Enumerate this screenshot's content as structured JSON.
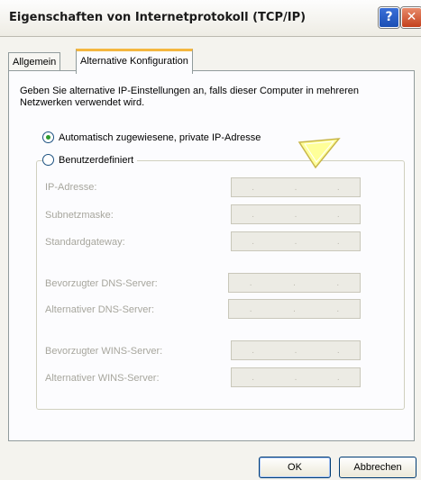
{
  "window": {
    "title": "Eigenschaften von Internetprotokoll (TCP/IP)",
    "help_glyph": "?",
    "close_glyph": "✕"
  },
  "tabs": [
    {
      "label": "Allgemein",
      "selected": false
    },
    {
      "label": "Alternative Konfiguration",
      "selected": true
    }
  ],
  "intro_text": "Geben Sie alternative IP-Einstellungen an, falls dieser Computer in mehreren Netzwerken verwendet wird.",
  "options": {
    "auto_label": "Automatisch zugewiesene, private IP-Adresse",
    "auto_selected": true,
    "custom_label": "Benutzerdefiniert",
    "custom_selected": false
  },
  "fields": {
    "ip_address": "IP-Adresse:",
    "subnet_mask": "Subnetzmaske:",
    "default_gateway": "Standardgateway:",
    "preferred_dns": "Bevorzugter DNS-Server:",
    "alternate_dns": "Alternativer DNS-Server:",
    "preferred_wins": "Bevorzugter WINS-Server:",
    "alternate_wins": "Alternativer WINS-Server:"
  },
  "ip_separator": ".",
  "buttons": {
    "ok": "OK",
    "cancel": "Abbrechen"
  },
  "colors": {
    "tab_highlight": "#f4b740",
    "disabled_text": "#a7a69d",
    "radio_dot": "#2d9b2d",
    "tooltip_arrow": "#ffff99"
  },
  "icons": {
    "help": "help-icon",
    "close": "close-icon",
    "annotation": "arrow-pointer-icon"
  }
}
